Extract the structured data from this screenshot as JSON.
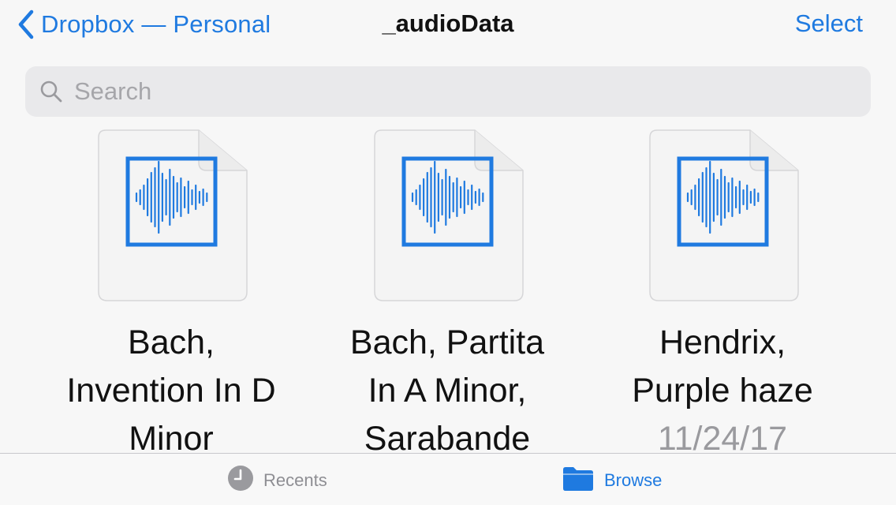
{
  "nav": {
    "back_label": "Dropbox — Personal",
    "title": "_audioData",
    "select_label": "Select"
  },
  "search": {
    "placeholder": "Search",
    "value": ""
  },
  "files": [
    {
      "name_lines": [
        "Bach,",
        "Invention In D",
        "Minor"
      ],
      "icon": "audio-waveform-icon"
    },
    {
      "name_lines": [
        "Bach, Partita",
        "In A Minor,",
        "Sarabande"
      ],
      "icon": "audio-waveform-icon"
    },
    {
      "name_lines": [
        "Hendrix,",
        "Purple haze"
      ],
      "date": "11/24/17",
      "icon": "audio-waveform-icon"
    }
  ],
  "tabs": [
    {
      "label": "Recents",
      "icon": "clock-icon",
      "active": false
    },
    {
      "label": "Browse",
      "icon": "folder-icon",
      "active": true
    }
  ],
  "colors": {
    "accent": "#1f7ae0",
    "inactive": "#8e8e93",
    "date": "#9a9a9e"
  }
}
